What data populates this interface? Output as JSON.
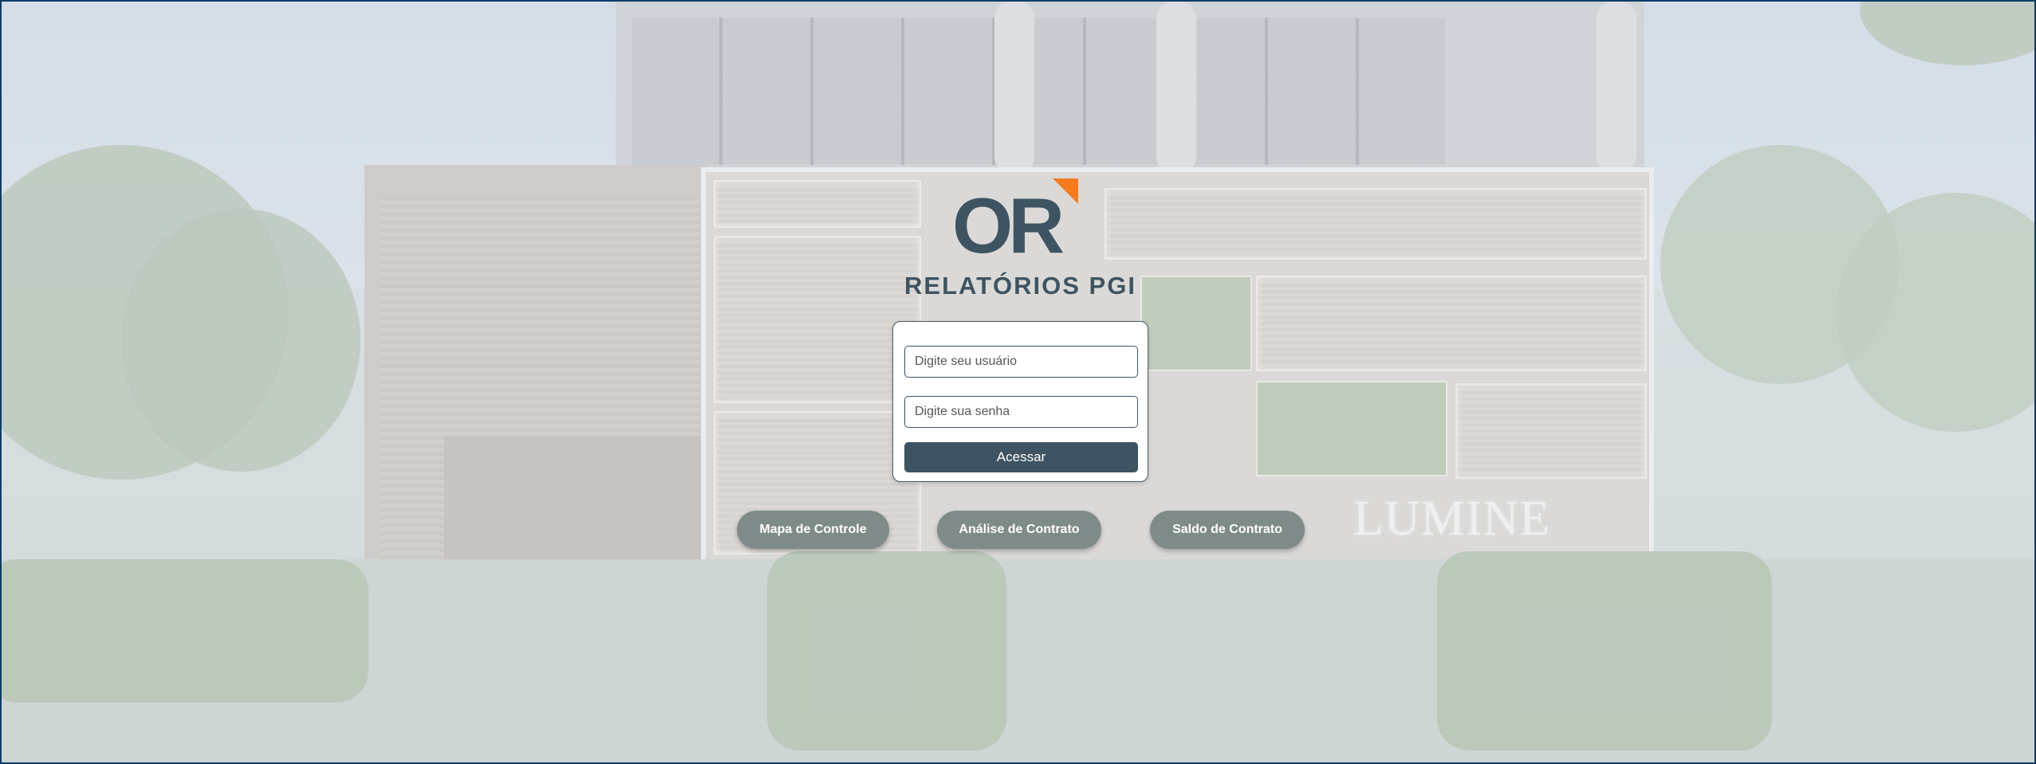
{
  "brand": {
    "logo_text": "OR",
    "accent_color": "#f47b20",
    "primary_color": "#3e5462",
    "title": "RELATÓRIOS PGI",
    "building_sign": "LUMINE"
  },
  "login": {
    "user_placeholder": "Digite seu usuário",
    "password_placeholder": "Digite sua senha",
    "submit_label": "Acessar"
  },
  "shortcuts": [
    {
      "label": "Mapa de Controle"
    },
    {
      "label": "Análise de Contrato"
    },
    {
      "label": "Saldo de Contrato"
    }
  ]
}
